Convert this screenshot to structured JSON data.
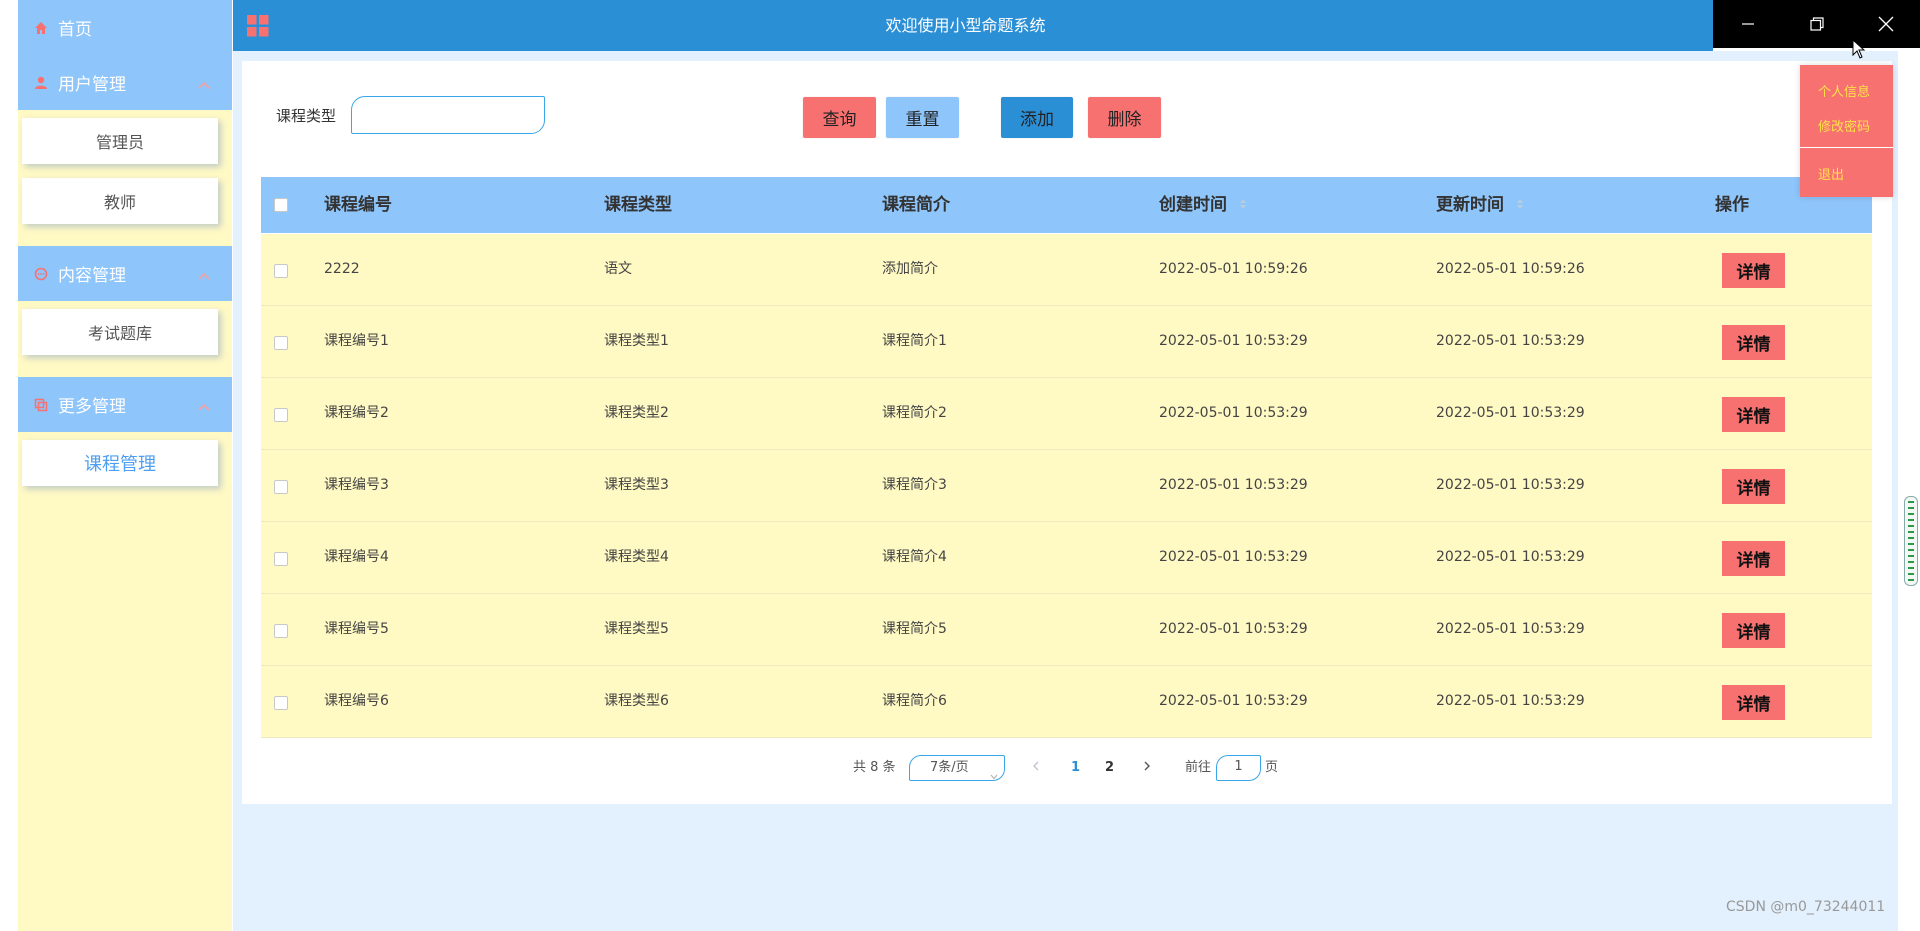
{
  "sidebar": {
    "home": "首页",
    "groups": [
      {
        "label": "用户管理",
        "icon": "user-icon",
        "items": [
          "管理员",
          "教师"
        ]
      },
      {
        "label": "内容管理",
        "icon": "chat-icon",
        "items": [
          "考试题库"
        ]
      },
      {
        "label": "更多管理",
        "icon": "copy-icon",
        "items": [
          "课程管理"
        ]
      }
    ]
  },
  "header": {
    "title": "欢迎使用小型命题系统"
  },
  "user_menu": {
    "items": [
      "个人信息",
      "修改密码",
      "退出"
    ]
  },
  "search": {
    "label": "课程类型",
    "value": ""
  },
  "toolbar": {
    "query": "查询",
    "reset": "重置",
    "add": "添加",
    "delete": "删除"
  },
  "colors": {
    "accent": "#2b8fd6",
    "header_row": "#8ec5fb",
    "row_bg": "#fff9c4",
    "danger": "#f87171",
    "sidebar_bg": "#fff9c4"
  },
  "table": {
    "columns": [
      "课程编号",
      "课程类型",
      "课程简介",
      "创建时间",
      "更新时间",
      "操作"
    ],
    "detail_label": "详情",
    "rows": [
      {
        "code": "2222",
        "type": "语文",
        "intro": "添加简介",
        "created": "2022-05-01 10:59:26",
        "updated": "2022-05-01 10:59:26"
      },
      {
        "code": "课程编号1",
        "type": "课程类型1",
        "intro": "课程简介1",
        "created": "2022-05-01 10:53:29",
        "updated": "2022-05-01 10:53:29"
      },
      {
        "code": "课程编号2",
        "type": "课程类型2",
        "intro": "课程简介2",
        "created": "2022-05-01 10:53:29",
        "updated": "2022-05-01 10:53:29"
      },
      {
        "code": "课程编号3",
        "type": "课程类型3",
        "intro": "课程简介3",
        "created": "2022-05-01 10:53:29",
        "updated": "2022-05-01 10:53:29"
      },
      {
        "code": "课程编号4",
        "type": "课程类型4",
        "intro": "课程简介4",
        "created": "2022-05-01 10:53:29",
        "updated": "2022-05-01 10:53:29"
      },
      {
        "code": "课程编号5",
        "type": "课程类型5",
        "intro": "课程简介5",
        "created": "2022-05-01 10:53:29",
        "updated": "2022-05-01 10:53:29"
      },
      {
        "code": "课程编号6",
        "type": "课程类型6",
        "intro": "课程简介6",
        "created": "2022-05-01 10:53:29",
        "updated": "2022-05-01 10:53:29"
      }
    ]
  },
  "pagination": {
    "total": "共 8 条",
    "page_size": "7条/页",
    "pages": [
      "1",
      "2"
    ],
    "current": "1",
    "goto_label": "前往",
    "goto_value": "1",
    "page_suffix": "页"
  },
  "watermark": "CSDN @m0_73244011"
}
